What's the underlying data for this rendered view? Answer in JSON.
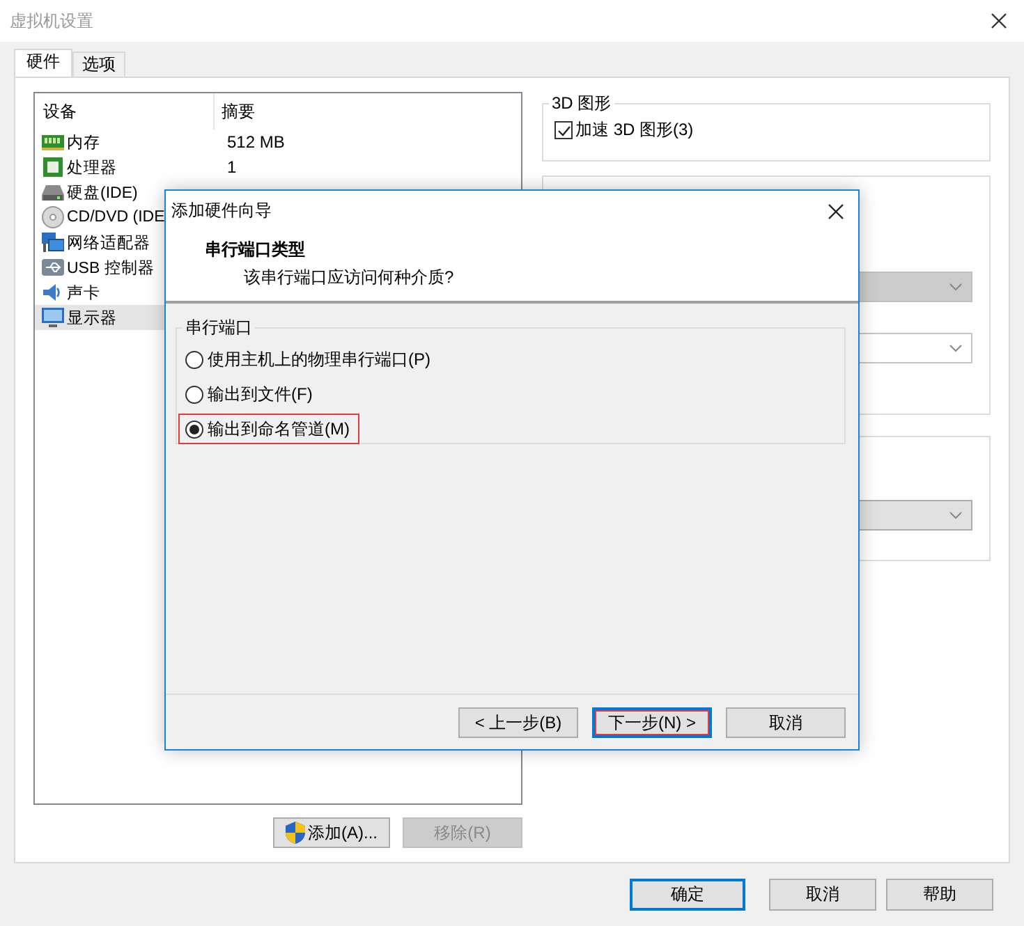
{
  "window": {
    "title": "虚拟机设置",
    "active": false
  },
  "tabs": [
    {
      "label": "硬件",
      "selected": true
    },
    {
      "label": "选项",
      "selected": false
    }
  ],
  "device_list": {
    "columns": [
      "设备",
      "摘要"
    ],
    "rows": [
      {
        "kind": "memory",
        "device": "内存",
        "summary": "512 MB",
        "selected": false
      },
      {
        "kind": "cpu",
        "device": "处理器",
        "summary": "1",
        "selected": false
      },
      {
        "kind": "disk",
        "device": "硬盘(IDE)",
        "selected": false
      },
      {
        "kind": "cd",
        "device": "CD/DVD (IDE",
        "selected": false
      },
      {
        "kind": "network",
        "device": "网络适配器",
        "selected": false
      },
      {
        "kind": "usb",
        "device": "USB 控制器",
        "selected": false
      },
      {
        "kind": "sound",
        "device": "声卡",
        "selected": false
      },
      {
        "kind": "display",
        "device": "显示器",
        "selected": true
      }
    ]
  },
  "list_buttons": [
    {
      "label": "添加(A)...",
      "disabled": false,
      "shield": true
    },
    {
      "label": "移除(R)",
      "disabled": true,
      "shield": false
    }
  ],
  "settings_groups": [
    {
      "title": "3D 图形",
      "checkbox": {
        "label": "加速 3D 图形(3)",
        "checked": true
      }
    },
    {
      "dropdowns": [
        {
          "disabled": true
        },
        {
          "disabled": false
        }
      ]
    },
    {
      "dropdowns": [
        {
          "disabled": false
        }
      ]
    }
  ],
  "dialog_buttons": [
    {
      "label": "确定",
      "default": true
    },
    {
      "label": "取消",
      "default": false
    },
    {
      "label": "帮助",
      "default": false
    }
  ],
  "wizard": {
    "title": "添加硬件向导",
    "heading": "串行端口类型",
    "subheading": "该串行端口应访问何种介质?",
    "group_title": "串行端口",
    "options": [
      {
        "label": "使用主机上的物理串行端口(P)",
        "selected": false,
        "highlighted": false
      },
      {
        "label": "输出到文件(F)",
        "selected": false,
        "highlighted": false
      },
      {
        "label": "输出到命名管道(M)",
        "selected": true,
        "highlighted": true
      }
    ],
    "buttons": [
      {
        "label": "< 上一步(B)",
        "default": false,
        "highlighted": false
      },
      {
        "label": "下一步(N) >",
        "default": true,
        "highlighted": true
      },
      {
        "label": "取消",
        "default": false,
        "highlighted": false
      }
    ]
  }
}
